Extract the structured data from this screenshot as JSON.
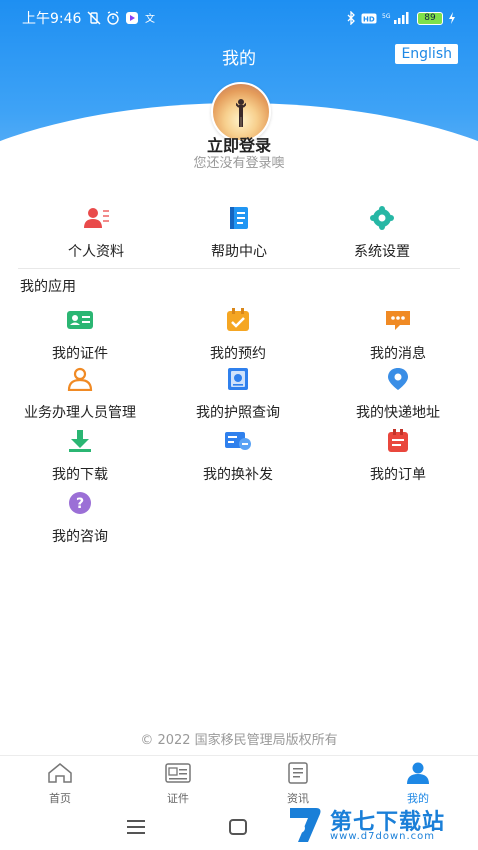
{
  "status_bar": {
    "time": "上午9:46",
    "battery": "89"
  },
  "header": {
    "title": "我的",
    "language_button": "English"
  },
  "login": {
    "title": "立即登录",
    "subtitle": "您还没有登录噢"
  },
  "quick_actions": [
    {
      "label": "个人资料",
      "icon": "profile-card-icon",
      "color": "#e94b4b"
    },
    {
      "label": "帮助中心",
      "icon": "help-book-icon",
      "color": "#2196f3"
    },
    {
      "label": "系统设置",
      "icon": "gear-icon",
      "color": "#26b7a5"
    }
  ],
  "apps_section": {
    "title": "我的应用",
    "items": [
      {
        "label": "我的证件",
        "icon": "id-card-icon",
        "color": "#2bb673"
      },
      {
        "label": "我的预约",
        "icon": "calendar-check-icon",
        "color": "#f5a623"
      },
      {
        "label": "我的消息",
        "icon": "message-icon",
        "color": "#f08a24"
      },
      {
        "label": "业务办理人员管理",
        "icon": "person-icon",
        "color": "#f08a24"
      },
      {
        "label": "我的护照查询",
        "icon": "passport-icon",
        "color": "#2f80ed"
      },
      {
        "label": "我的快递地址",
        "icon": "location-pin-icon",
        "color": "#3a8ee6"
      },
      {
        "label": "我的下载",
        "icon": "download-icon",
        "color": "#2bb673"
      },
      {
        "label": "我的换补发",
        "icon": "reissue-icon",
        "color": "#2f80ed"
      },
      {
        "label": "我的订单",
        "icon": "order-icon",
        "color": "#e9473d"
      },
      {
        "label": "我的咨询",
        "icon": "question-icon",
        "color": "#9b6fd6"
      }
    ]
  },
  "footer": {
    "copyright": "© 2022 国家移民管理局版权所有"
  },
  "tabbar": {
    "tabs": [
      {
        "label": "首页",
        "icon": "home-icon",
        "active": false
      },
      {
        "label": "证件",
        "icon": "document-icon",
        "active": false
      },
      {
        "label": "资讯",
        "icon": "news-icon",
        "active": false
      },
      {
        "label": "我的",
        "icon": "user-icon",
        "active": true
      }
    ]
  },
  "watermark": {
    "text": "第七下载站",
    "url": "www.d7down.com"
  },
  "colors": {
    "primary": "#1e88e5",
    "header_gradient_top": "#1e8ff2"
  }
}
